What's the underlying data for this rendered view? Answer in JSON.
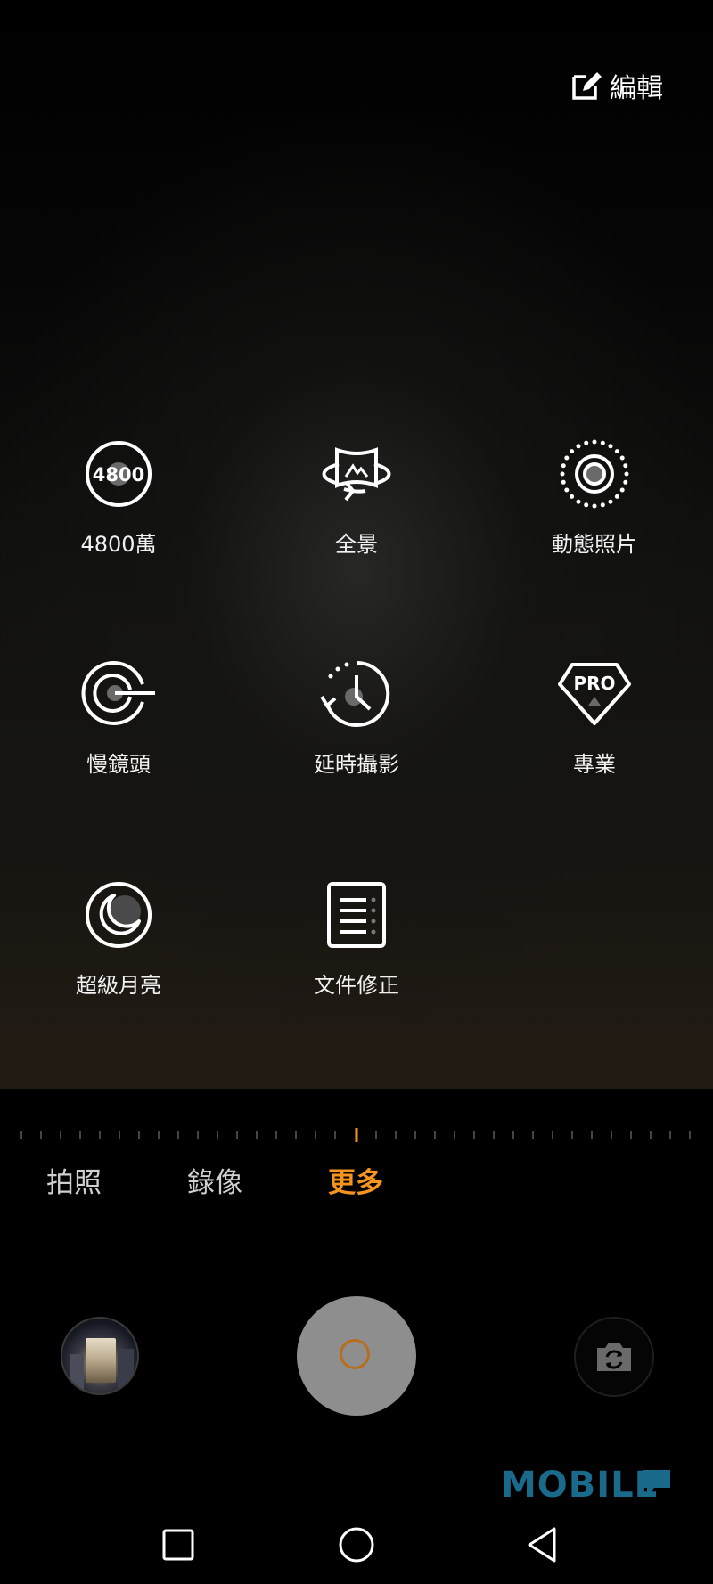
{
  "header": {
    "edit_label": "編輯"
  },
  "modes": [
    {
      "label": "4800萬",
      "icon": "4800mp-icon",
      "icon_text": "4800"
    },
    {
      "label": "全景",
      "icon": "panorama-icon"
    },
    {
      "label": "動態照片",
      "icon": "moving-picture-icon"
    },
    {
      "label": "慢鏡頭",
      "icon": "slow-motion-icon"
    },
    {
      "label": "延時攝影",
      "icon": "time-lapse-icon"
    },
    {
      "label": "專業",
      "icon": "pro-mode-icon",
      "icon_text": "PRO"
    },
    {
      "label": "超級月亮",
      "icon": "super-moon-icon"
    },
    {
      "label": "文件修正",
      "icon": "document-scan-icon"
    }
  ],
  "mode_tabs": [
    {
      "label": "拍照",
      "active": false
    },
    {
      "label": "錄像",
      "active": false
    },
    {
      "label": "更多",
      "active": true
    }
  ],
  "watermark": "MOBILE",
  "colors": {
    "accent": "#f7941d",
    "shutter": "#8e8e8e",
    "watermark": "#1a6a8c"
  },
  "nav": [
    "recent-apps-icon",
    "home-icon",
    "back-icon"
  ]
}
